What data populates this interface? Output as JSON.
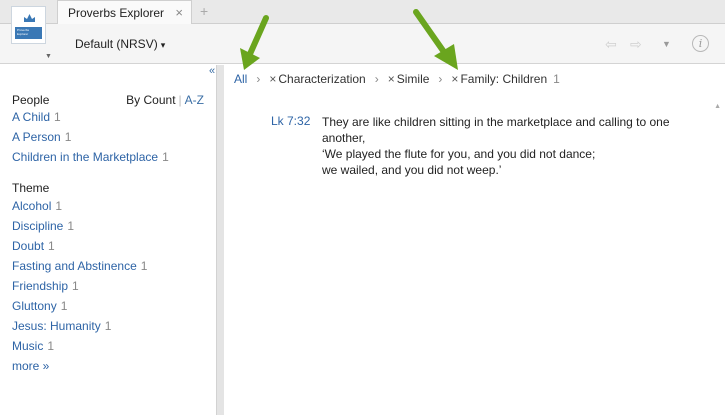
{
  "tab": {
    "title": "Proverbs Explorer",
    "close": "×",
    "new": "+"
  },
  "toolbar": {
    "version": "Default (NRSV)",
    "version_caret": "▾",
    "info": "i"
  },
  "app_icon": {
    "label": "Proverbs Explorer"
  },
  "sidebar": {
    "collapse": "«",
    "people": {
      "heading": "People",
      "sort_by": "By Count",
      "sort_sep": "|",
      "sort_az": "A-Z",
      "items": [
        {
          "label": "A Child",
          "count": "1"
        },
        {
          "label": "A Person",
          "count": "1"
        },
        {
          "label": "Children in the Marketplace",
          "count": "1"
        }
      ]
    },
    "theme": {
      "heading": "Theme",
      "items": [
        {
          "label": "Alcohol",
          "count": "1"
        },
        {
          "label": "Discipline",
          "count": "1"
        },
        {
          "label": "Doubt",
          "count": "1"
        },
        {
          "label": "Fasting and Abstinence",
          "count": "1"
        },
        {
          "label": "Friendship",
          "count": "1"
        },
        {
          "label": "Gluttony",
          "count": "1"
        },
        {
          "label": "Jesus: Humanity",
          "count": "1"
        },
        {
          "label": "Music",
          "count": "1"
        }
      ],
      "more": "more »"
    }
  },
  "breadcrumb": {
    "all": "All",
    "arrow": "›",
    "remove": "×",
    "filters": [
      {
        "label": "Characterization"
      },
      {
        "label": "Simile"
      },
      {
        "label": "Family: Children",
        "count": "1"
      }
    ]
  },
  "entry": {
    "reference": "Lk 7:32",
    "lines": [
      "They are like children sitting in the marketplace and calling to one",
      "another,",
      "‘We played the flute for you, and you did not dance;",
      "we wailed, and you did not weep.’"
    ]
  },
  "colors": {
    "link": "#2e64a6",
    "arrow_green": "#6aa51e",
    "count_gray": "#888888"
  }
}
